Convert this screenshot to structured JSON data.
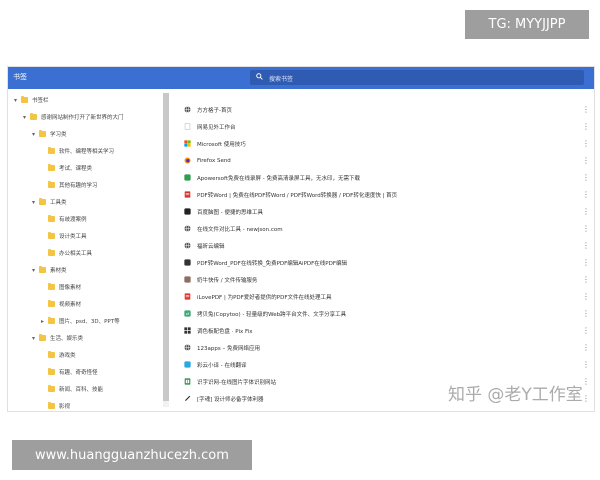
{
  "watermarks": {
    "top": "TG: MYYJJPP",
    "bottom": "www.huangguanzhucezh.com",
    "zhihu": "知乎 @老Y工作室"
  },
  "app": {
    "title": "书签",
    "search_placeholder": "搜索书签",
    "accent": "#3b6fd1"
  },
  "sidebar": {
    "items": [
      {
        "label": "书签栏",
        "depth": 0,
        "expand": "open"
      },
      {
        "label": "感谢网站制作打开了新世界的大门",
        "depth": 1,
        "expand": "open"
      },
      {
        "label": "学习类",
        "depth": 2,
        "expand": "open"
      },
      {
        "label": "软件、编程等相关学习",
        "depth": 3,
        "expand": "none"
      },
      {
        "label": "考试、课程类",
        "depth": 3,
        "expand": "none"
      },
      {
        "label": "其他有趣的学习",
        "depth": 3,
        "expand": "none"
      },
      {
        "label": "工具类",
        "depth": 2,
        "expand": "open"
      },
      {
        "label": "有歧渡案例",
        "depth": 3,
        "expand": "none"
      },
      {
        "label": "设计类工具",
        "depth": 3,
        "expand": "none"
      },
      {
        "label": "办公相关工具",
        "depth": 3,
        "expand": "none"
      },
      {
        "label": "素材类",
        "depth": 2,
        "expand": "open"
      },
      {
        "label": "图像素材",
        "depth": 3,
        "expand": "none"
      },
      {
        "label": "视频素材",
        "depth": 3,
        "expand": "none"
      },
      {
        "label": "图片、psd、3D、PPT等",
        "depth": 3,
        "expand": "closed"
      },
      {
        "label": "生活、娱乐类",
        "depth": 2,
        "expand": "open"
      },
      {
        "label": "游戏类",
        "depth": 3,
        "expand": "none"
      },
      {
        "label": "有趣、奇奇怪怪",
        "depth": 3,
        "expand": "none"
      },
      {
        "label": "新闻、百科、技能",
        "depth": 3,
        "expand": "none"
      },
      {
        "label": "影视",
        "depth": 3,
        "expand": "none"
      }
    ]
  },
  "bookmarks": [
    {
      "title": "方方格子-首页",
      "icon": "globe-icon",
      "color": "#555555"
    },
    {
      "title": "网易见外工作台",
      "icon": "blank-icon",
      "color": "#bbbbbb"
    },
    {
      "title": "Microsoft 使用技巧",
      "icon": "microsoft-icon",
      "color": "#0078d4"
    },
    {
      "title": "Firefox Send",
      "icon": "firefox-icon",
      "color": "#e66000"
    },
    {
      "title": "Apowersoft免费在线录屏 - 免费高清录屏工具，无水印，无需下载",
      "icon": "apowersoft-icon",
      "color": "#2e9e4f"
    },
    {
      "title": "PDF转Word | 免费在线PDF转Word / PDF转Word转换器 / PDF转化速度快 | 首页",
      "icon": "pdf-icon",
      "color": "#d9322a"
    },
    {
      "title": "百度脑图 - 便捷的思维工具",
      "icon": "baidu-naotu-icon",
      "color": "#222222"
    },
    {
      "title": "在线文件对比工具 - newjson.com",
      "icon": "globe-icon",
      "color": "#555555"
    },
    {
      "title": "福昕云编辑",
      "icon": "globe-icon",
      "color": "#555555"
    },
    {
      "title": "PDF转Word_PDF在线转换_免费PDF编辑AiPDF在线PDF编辑",
      "icon": "aipdf-icon",
      "color": "#333333"
    },
    {
      "title": "奶牛快传 / 文件传输服务",
      "icon": "cow-icon",
      "color": "#8d6e63"
    },
    {
      "title": "iLovePDF | 为PDF爱好者提供的PDF文件在线处理工具",
      "icon": "ilovepdf-icon",
      "color": "#e5322d"
    },
    {
      "title": "拷贝兔(Copytoo) - 轻量级的Web跨平台文件、文字分享工具",
      "icon": "copytoo-icon",
      "color": "#3aa876"
    },
    {
      "title": "调色板配色盘 · Pix Fix",
      "icon": "pixfix-icon",
      "color": "#333333"
    },
    {
      "title": "123apps – 免费网络应用",
      "icon": "globe-icon",
      "color": "#555555"
    },
    {
      "title": "彩云小译 - 在线翻译",
      "icon": "caiyun-icon",
      "color": "#2aa7df"
    },
    {
      "title": "识字识网-在线图片字体识别网站",
      "icon": "sheet-icon",
      "color": "#1e8e3e"
    },
    {
      "title": "[字魂] 设计师必备字体利器",
      "icon": "pen-icon",
      "color": "#333333"
    }
  ]
}
